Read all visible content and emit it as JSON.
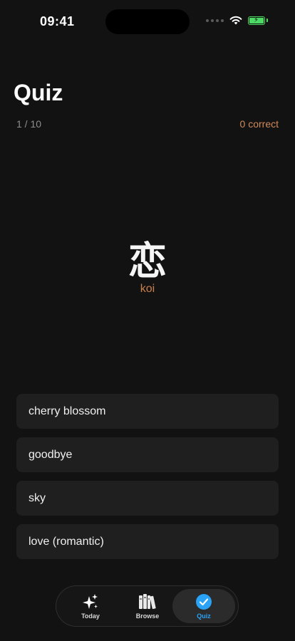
{
  "status_bar": {
    "time": "09:41"
  },
  "header": {
    "title": "Quiz",
    "progress": "1 / 10",
    "score": "0 correct"
  },
  "question": {
    "kanji": "恋",
    "reading": "koi"
  },
  "options": [
    {
      "label": "cherry blossom"
    },
    {
      "label": "goodbye"
    },
    {
      "label": "sky"
    },
    {
      "label": "love (romantic)"
    }
  ],
  "tabs": [
    {
      "label": "Today",
      "icon": "sparkles-icon"
    },
    {
      "label": "Browse",
      "icon": "books-icon"
    },
    {
      "label": "Quiz",
      "icon": "checkmark-circle-icon",
      "selected": true
    }
  ],
  "colors": {
    "accent": "#c8804d",
    "selected_tab": "#2aa2f5",
    "battery": "#4cd964"
  }
}
